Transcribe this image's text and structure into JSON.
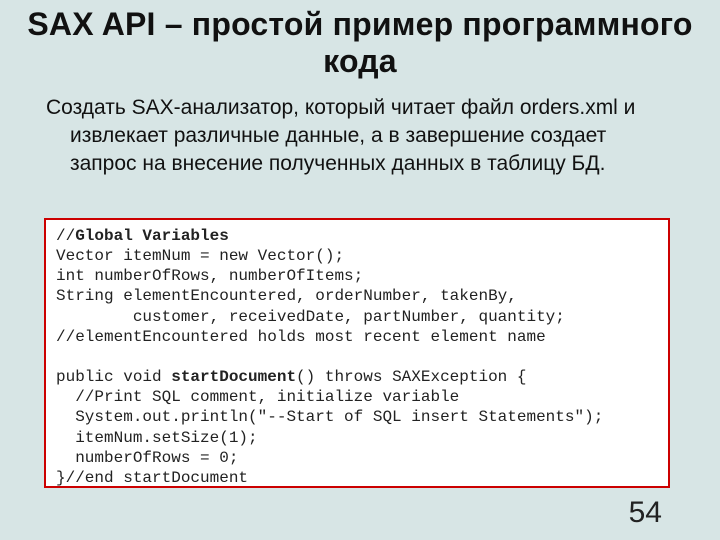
{
  "title": "SAX API – простой пример программного кода",
  "description_line1": "Создать SAX-анализатор, который читает файл orders.xml и",
  "description_line2": "извлекает различные данные, а в завершение создает",
  "description_line3": "запрос на внесение полученных данных в таблицу БД.",
  "code": {
    "l1a": "//",
    "l1b": "Global Variables",
    "l2": "Vector itemNum = new Vector();",
    "l3": "int numberOfRows, numberOfItems;",
    "l4": "String elementEncountered, orderNumber, takenBy,",
    "l5": "        customer, receivedDate, partNumber, quantity;",
    "l6": "//elementEncountered holds most recent element name",
    "l7": "",
    "l8a": "public void ",
    "l8b": "startDocument",
    "l8c": "() throws SAXException {",
    "l9": "  //Print SQL comment, initialize variable",
    "l10": "  System.out.println(\"--Start of SQL insert Statements\");",
    "l11": "  itemNum.setSize(1);",
    "l12": "  numberOfRows = 0;",
    "l13": "}//end startDocument"
  },
  "page_number": "54"
}
